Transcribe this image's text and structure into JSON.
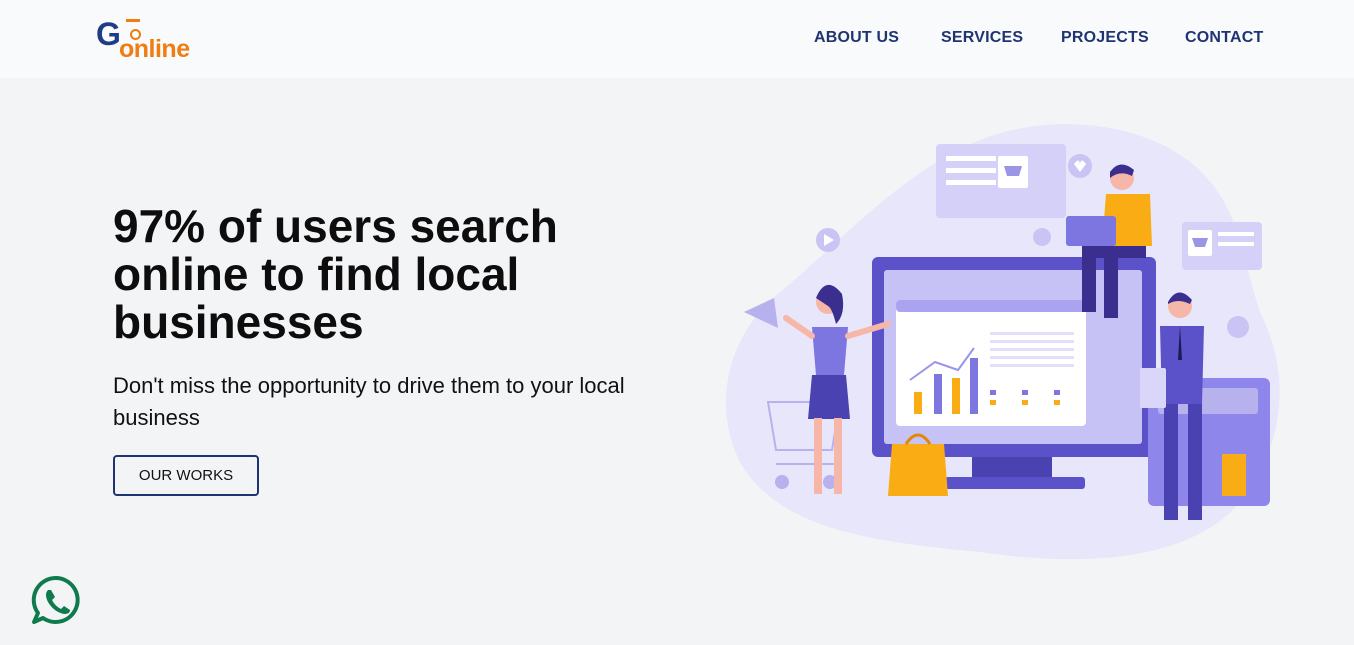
{
  "header": {
    "logo": {
      "word1": "G",
      "word2": "online"
    },
    "nav": [
      {
        "label": "ABOUT US"
      },
      {
        "label": "SERVICES"
      },
      {
        "label": "PROJECTS"
      },
      {
        "label": "CONTACT"
      }
    ]
  },
  "hero": {
    "title": "97% of users search online to find local businesses",
    "subtitle": "Don't miss the opportunity to drive them to your local business",
    "cta_label": "OUR WORKS"
  },
  "colors": {
    "brand_blue": "#1f3c88",
    "brand_orange": "#f07c12",
    "nav_text": "#1f3470",
    "illustration_purple": "#5b52c9",
    "illustration_lavender": "#e8e6fb",
    "accent_yellow": "#f9ac14",
    "whatsapp_green": "#0f7a4b"
  },
  "icons": {
    "floating_chat": "whatsapp-icon"
  }
}
